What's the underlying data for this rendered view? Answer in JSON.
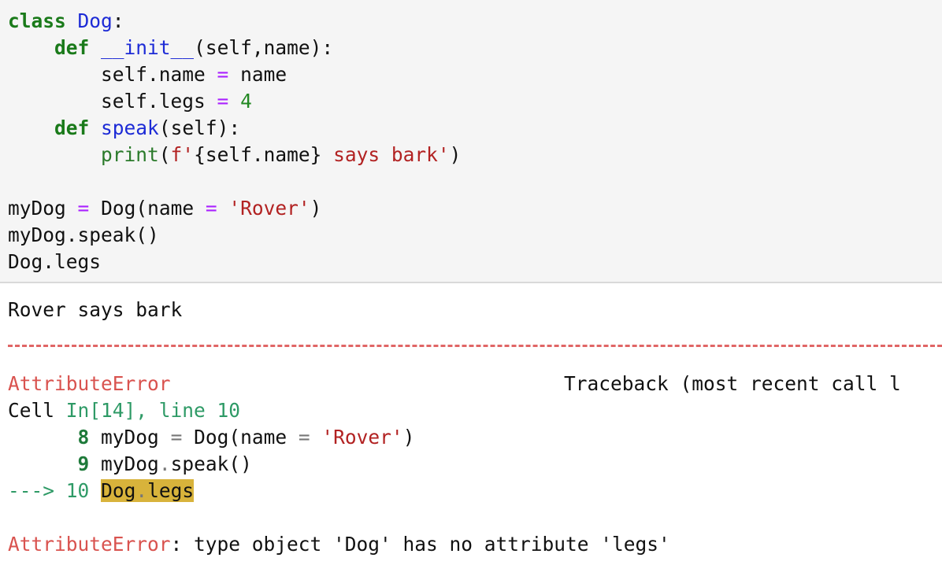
{
  "code": {
    "l1": {
      "kw": "class",
      "name": "Dog",
      "rest": ":"
    },
    "l2": {
      "kw": "def",
      "name": "__init__",
      "rest": "(self,name):"
    },
    "l3": {
      "a": "self.name",
      "op": "=",
      "b": "name"
    },
    "l4": {
      "a": "self.legs",
      "op": "=",
      "num": "4"
    },
    "l5": {
      "kw": "def",
      "name": "speak",
      "rest": "(self):"
    },
    "l6": {
      "fn": "print",
      "p1": "(",
      "fpre": "f'",
      "interp": "{self.name}",
      "str": " says bark'",
      "p2": ")"
    },
    "l8": {
      "a": "myDog",
      "op1": "=",
      "b": "Dog(name",
      "op2": "=",
      "str": "'Rover'",
      "c": ")"
    },
    "l9": {
      "text": "myDog.speak()"
    },
    "l10": {
      "text": "Dog.legs"
    }
  },
  "output": {
    "stdout": "Rover says bark",
    "err_name": "AttributeError",
    "traceback_label": "Traceback (most recent call l",
    "cell_prefix": "Cell",
    "cell_ref": "In[14], line 10",
    "tb8": {
      "num": "8",
      "a": "myDog",
      "op1": "=",
      "b": "Dog(name",
      "op2": "=",
      "str": "'Rover'",
      "c": ")"
    },
    "tb9": {
      "num": "9",
      "a": "myDog",
      "dot": ".",
      "b": "speak()"
    },
    "tb10": {
      "arrow": "--->",
      "num": "10",
      "a": "Dog",
      "dot": ".",
      "b": "legs"
    },
    "final_name": "AttributeError",
    "final_msg": ": type object 'Dog' has no attribute 'legs'"
  }
}
